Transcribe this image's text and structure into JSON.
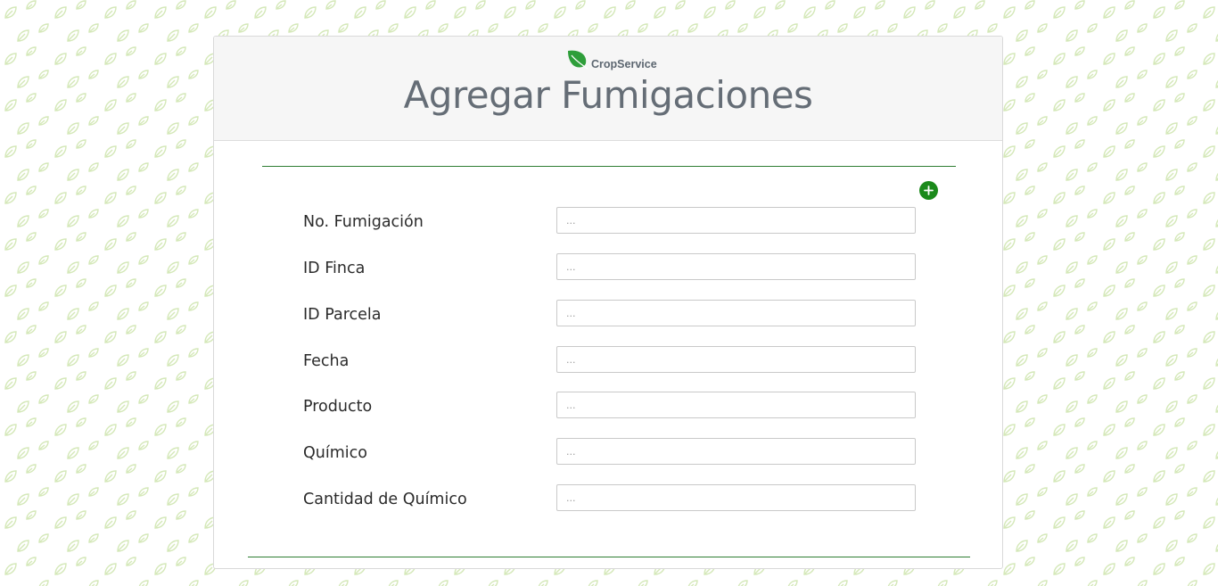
{
  "brand": {
    "name": "CropService",
    "logo_icon": "leaf-icon",
    "logo_color": "#2e9e3a"
  },
  "page": {
    "title": "Agregar Fumigaciones"
  },
  "add_button": {
    "icon": "plus-icon",
    "color": "#1b8a1b"
  },
  "background": {
    "pattern_icon": "leaf-icon",
    "pattern_color": "#cfe6b0"
  },
  "form": {
    "fields": [
      {
        "label": "No. Fumigación",
        "placeholder": "...",
        "value": ""
      },
      {
        "label": "ID Finca",
        "placeholder": "...",
        "value": ""
      },
      {
        "label": "ID Parcela",
        "placeholder": "...",
        "value": ""
      },
      {
        "label": "Fecha",
        "placeholder": "...",
        "value": ""
      },
      {
        "label": "Producto",
        "placeholder": "...",
        "value": ""
      },
      {
        "label": "Químico",
        "placeholder": "...",
        "value": ""
      },
      {
        "label": "Cantidad de Químico",
        "placeholder": "...",
        "value": ""
      }
    ]
  },
  "colors": {
    "accent": "#2e7d32",
    "title_text": "#656d76",
    "header_bg": "#f6f6f6"
  }
}
